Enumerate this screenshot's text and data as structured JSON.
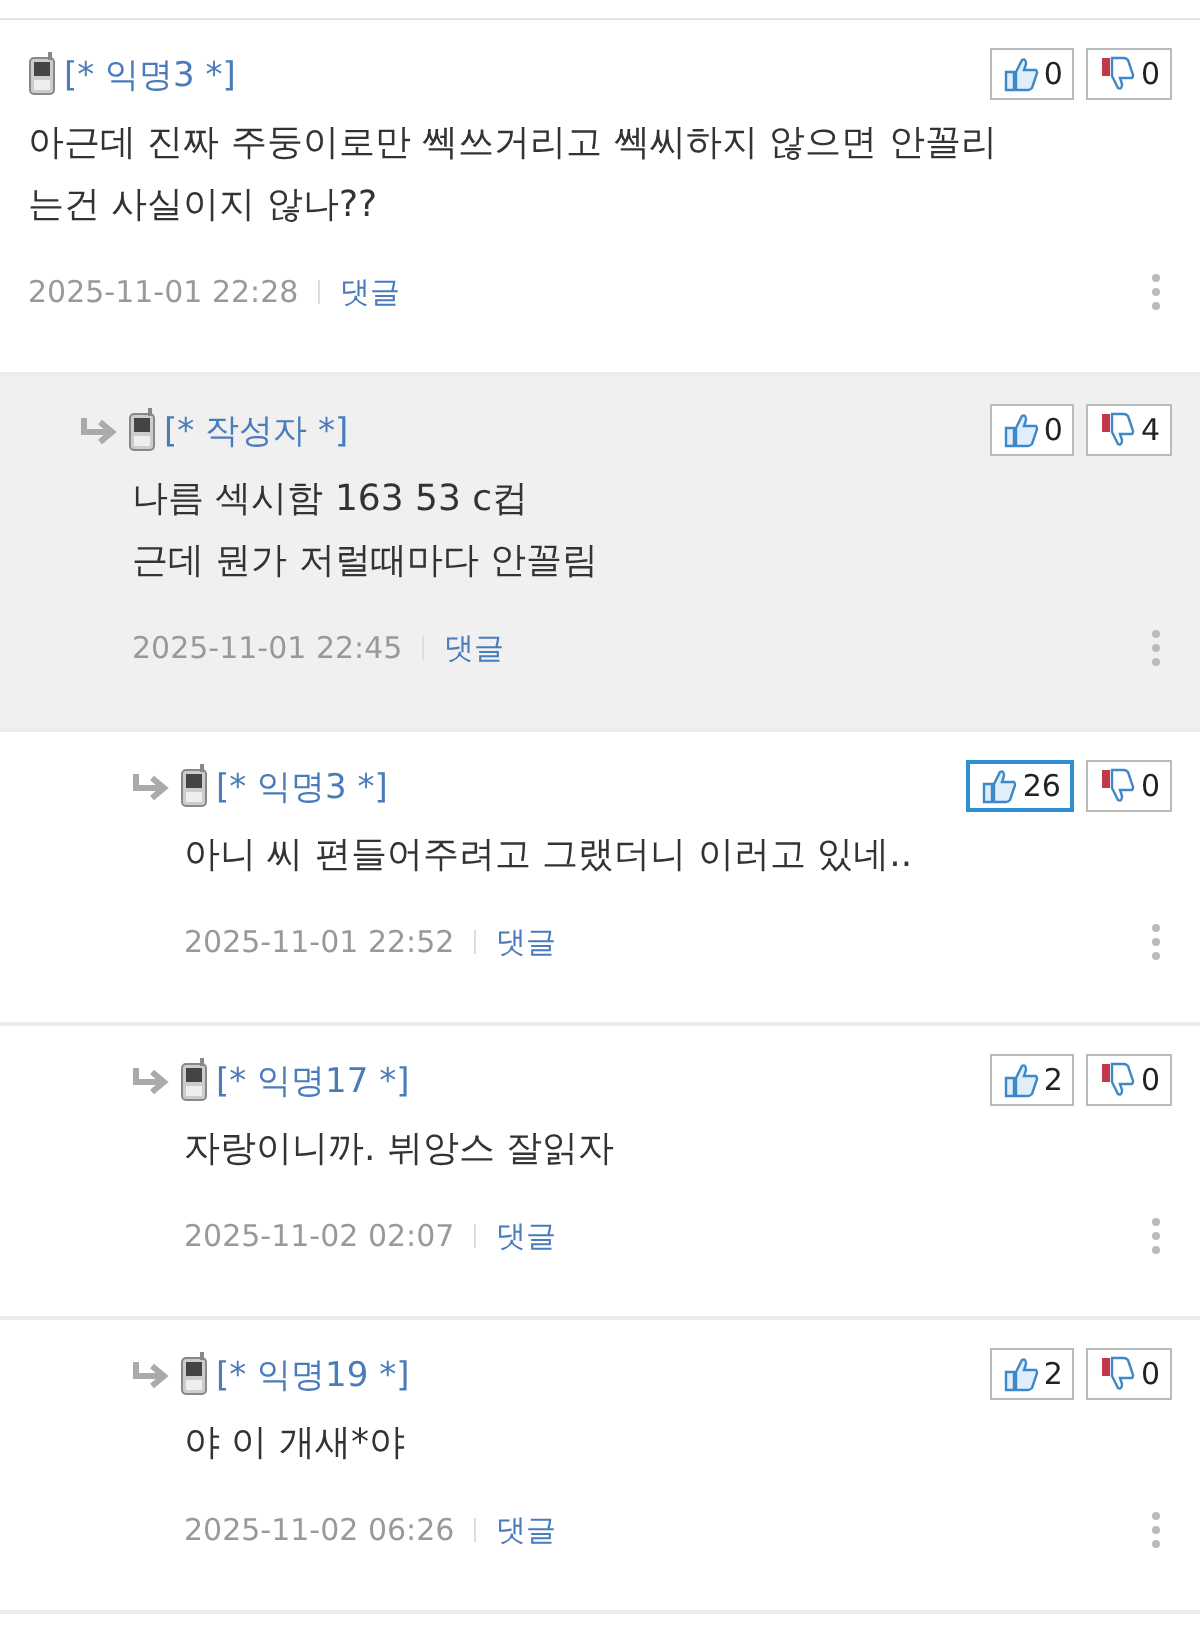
{
  "comments": [
    {
      "author": "[* 익명3 *]",
      "by_author": false,
      "likes": "0",
      "dislikes": "0",
      "like_highlighted": false,
      "text": [
        "아근데 진짜 주둥이로만 쎅쓰거리고 쎅씨하지 않으면 안꼴리",
        "는건 사실이지 않나??"
      ],
      "date": "2025-11-01 22:28",
      "reply": "댓글",
      "children": [
        {
          "author": "[* 작성자 *]",
          "by_author": true,
          "likes": "0",
          "dislikes": "4",
          "like_highlighted": false,
          "text": [
            "나름 섹시함 163 53 c컵",
            "근데 뭔가 저럴때마다 안꼴림"
          ],
          "date": "2025-11-01 22:45",
          "reply": "댓글",
          "children": [
            {
              "author": "[* 익명3 *]",
              "by_author": false,
              "likes": "26",
              "dislikes": "0",
              "like_highlighted": true,
              "text": [
                "아니 씨 편들어주려고 그랬더니 이러고 있네.."
              ],
              "date": "2025-11-01 22:52",
              "reply": "댓글"
            },
            {
              "author": "[* 익명17 *]",
              "by_author": false,
              "likes": "2",
              "dislikes": "0",
              "like_highlighted": false,
              "text": [
                "자랑이니까. 뷔앙스 잘읽자"
              ],
              "date": "2025-11-02 02:07",
              "reply": "댓글"
            },
            {
              "author": "[* 익명19 *]",
              "by_author": false,
              "likes": "2",
              "dislikes": "0",
              "like_highlighted": false,
              "text": [
                "야 이 개새*야"
              ],
              "date": "2025-11-02 06:26",
              "reply": "댓글"
            }
          ]
        }
      ]
    }
  ]
}
